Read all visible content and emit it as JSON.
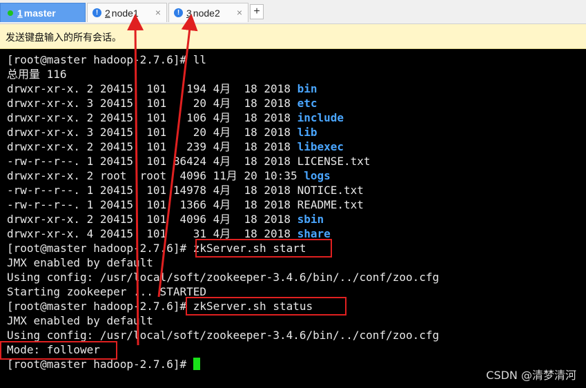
{
  "tabs": [
    {
      "num": "1",
      "label": "master",
      "active": true
    },
    {
      "num": "2",
      "label": "node1",
      "active": false
    },
    {
      "num": "3",
      "label": "node2",
      "active": false
    }
  ],
  "tab_add_symbol": "+",
  "tab_close_symbol": "×",
  "tab_warning_symbol": "!",
  "notice": "发送键盘输入的所有会话。",
  "terminal": {
    "l0": "[root@master hadoop-2.7.6]# ll",
    "l1": "总用量 116",
    "listing": [
      {
        "perm": "drwxr-xr-x. 2 20415  101   194 4月  18 2018 ",
        "name": "bin",
        "dir": true
      },
      {
        "perm": "drwxr-xr-x. 3 20415  101    20 4月  18 2018 ",
        "name": "etc",
        "dir": true
      },
      {
        "perm": "drwxr-xr-x. 2 20415  101   106 4月  18 2018 ",
        "name": "include",
        "dir": true
      },
      {
        "perm": "drwxr-xr-x. 3 20415  101    20 4月  18 2018 ",
        "name": "lib",
        "dir": true
      },
      {
        "perm": "drwxr-xr-x. 2 20415  101   239 4月  18 2018 ",
        "name": "libexec",
        "dir": true
      },
      {
        "perm": "-rw-r--r--. 1 20415  101 86424 4月  18 2018 ",
        "name": "LICENSE.txt",
        "dir": false
      },
      {
        "perm": "drwxr-xr-x. 2 root  root  4096 11月 20 10:35 ",
        "name": "logs",
        "dir": true
      },
      {
        "perm": "-rw-r--r--. 1 20415  101 14978 4月  18 2018 ",
        "name": "NOTICE.txt",
        "dir": false
      },
      {
        "perm": "-rw-r--r--. 1 20415  101  1366 4月  18 2018 ",
        "name": "README.txt",
        "dir": false
      },
      {
        "perm": "drwxr-xr-x. 2 20415  101  4096 4月  18 2018 ",
        "name": "sbin",
        "dir": true
      },
      {
        "perm": "drwxr-xr-x. 4 20415  101    31 4月  18 2018 ",
        "name": "share",
        "dir": true
      }
    ],
    "prompt": "[root@master hadoop-2.7.6]# ",
    "cmd_start": "zkServer.sh start",
    "jmx1": "JMX enabled by default",
    "config1": "Using config: /usr/local/soft/zookeeper-3.4.6/bin/../conf/zoo.cfg",
    "starting": "Starting zookeeper ... STARTED",
    "cmd_status": "zkServer.sh status",
    "jmx2": "JMX enabled by default",
    "config2": "Using config: /usr/local/soft/zookeeper-3.4.6/bin/../conf/zoo.cfg",
    "mode": "Mode: follower",
    "last_prompt": "[root@master hadoop-2.7.6]# "
  },
  "watermark": "CSDN @清梦清河",
  "colors": {
    "active_tab": "#5e9ff0",
    "annotation": "#e02020",
    "cursor": "#19e019",
    "dir_name": "#4aa6ff"
  }
}
